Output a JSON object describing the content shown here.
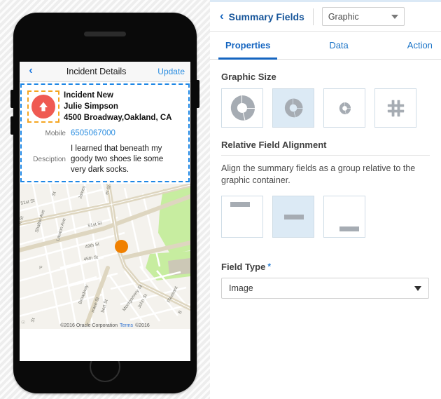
{
  "phone": {
    "nav": {
      "back_icon": "chevron-left-icon",
      "title": "Incident Details",
      "action": "Update"
    },
    "card": {
      "avatar_icon": "up-arrow-avatar-icon",
      "lines": [
        "Incident New",
        "Julie Simpson",
        "4500 Broadway,Oakland, CA"
      ],
      "fields": [
        {
          "label": "Mobile",
          "value": "6505067000"
        },
        {
          "label": "Desciption",
          "value": "I learned that beneath my goody two shoes lie some very dark socks."
        }
      ]
    },
    "map": {
      "marker_icon": "location-marker-icon",
      "credit": "©2016 Oracle Corporation",
      "terms": "Terms",
      "credit2": "©2016",
      "streets": [
        "51st St",
        "49th St",
        "45th St",
        "Shafter Ave",
        "Lawton Ave",
        "Broadway",
        "Montgomery St",
        "John St",
        "Pleasant Ave",
        "James",
        "Webster St",
        "Manila Ave",
        "Clarke St",
        "Hubert St"
      ]
    }
  },
  "panel": {
    "header": {
      "back_icon": "chevron-left-icon",
      "title": "Summary Fields",
      "select_value": "Graphic",
      "caret_icon": "chevron-down-icon"
    },
    "tabs": [
      {
        "label": "Properties",
        "active": true
      },
      {
        "label": "Data",
        "active": false
      },
      {
        "label": "Action",
        "active": false
      }
    ],
    "graphic_size": {
      "title": "Graphic Size",
      "options": [
        {
          "icon": "donut-large-icon",
          "selected": false
        },
        {
          "icon": "donut-medium-icon",
          "selected": true
        },
        {
          "icon": "donut-small-icon",
          "selected": false
        },
        {
          "icon": "hash-grid-icon",
          "selected": false
        }
      ]
    },
    "alignment": {
      "title": "Relative Field Alignment",
      "description": "Align the summary fields as a group relative to the graphic container.",
      "options": [
        {
          "icon": "align-top-icon",
          "selected": false
        },
        {
          "icon": "align-middle-icon",
          "selected": true
        },
        {
          "icon": "align-bottom-icon",
          "selected": false
        }
      ]
    },
    "field_type": {
      "label": "Field Type",
      "required_marker": "*",
      "value": "Image",
      "caret_icon": "chevron-down-icon"
    }
  },
  "colors": {
    "accent_blue": "#1565c0",
    "link_blue": "#2a8de0",
    "selected_tile": "#dceaf5",
    "avatar_red": "#ef5a52",
    "marker_orange": "#f08000",
    "selection_blue": "#1e87e5",
    "selection_orange": "#f5a623",
    "icon_gray": "#a6acb3"
  }
}
